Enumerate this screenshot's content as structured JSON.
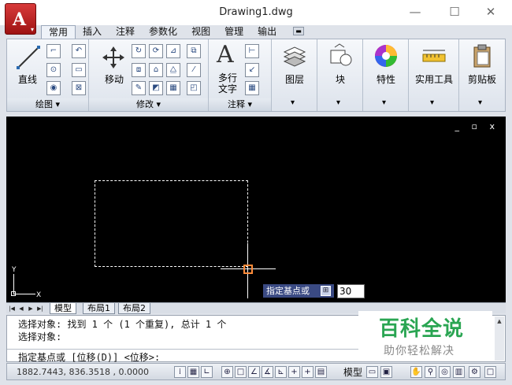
{
  "window": {
    "title": "Drawing1.dwg",
    "controls": {
      "minimize": "—",
      "maximize": "☐",
      "close": "✕"
    },
    "app_button": {
      "letter": "A",
      "caret": "▾"
    }
  },
  "tabs": [
    "常用",
    "插入",
    "注释",
    "参数化",
    "视图",
    "管理",
    "输出"
  ],
  "tab_extra": "▬",
  "ribbon": {
    "draw": {
      "line_label": "直线",
      "panel_label": "绘图 ▾"
    },
    "modify": {
      "move_label": "移动",
      "panel_label": "修改 ▾"
    },
    "annotation": {
      "text_label_1": "多行",
      "text_label_2": "文字",
      "panel_label": "注释 ▾"
    },
    "layers": {
      "label": "图层",
      "arrow": "▾"
    },
    "block": {
      "label": "块",
      "arrow": "▾"
    },
    "properties": {
      "label": "特性",
      "arrow": "▾"
    },
    "utilities": {
      "label": "实用工具",
      "arrow": "▾"
    },
    "clipboard": {
      "label": "剪贴板",
      "arrow": "▾"
    }
  },
  "drawing": {
    "view_controls": "_ ▫ x",
    "tooltip": "指定基点或",
    "tooltip_button": "⊞",
    "dynamic_input": "30",
    "ucs_y": "Y",
    "ucs_x": "X"
  },
  "layout_tabs": {
    "nav": [
      "|◀",
      "◀",
      "▶",
      "▶|"
    ],
    "tabs": [
      "模型",
      "布局1",
      "布局2"
    ]
  },
  "command": {
    "line1": "选择对象: 找到 1 个 (1 个重复), 总计 1 个",
    "line2": "选择对象:",
    "prompt": "指定基点或 [位移(D)] <位移>:"
  },
  "watermark": {
    "big": "百科全说",
    "small": "助你轻松解决"
  },
  "status": {
    "coords": "1882.7443, 836.3518 , 0.0000",
    "model": "模型"
  }
}
